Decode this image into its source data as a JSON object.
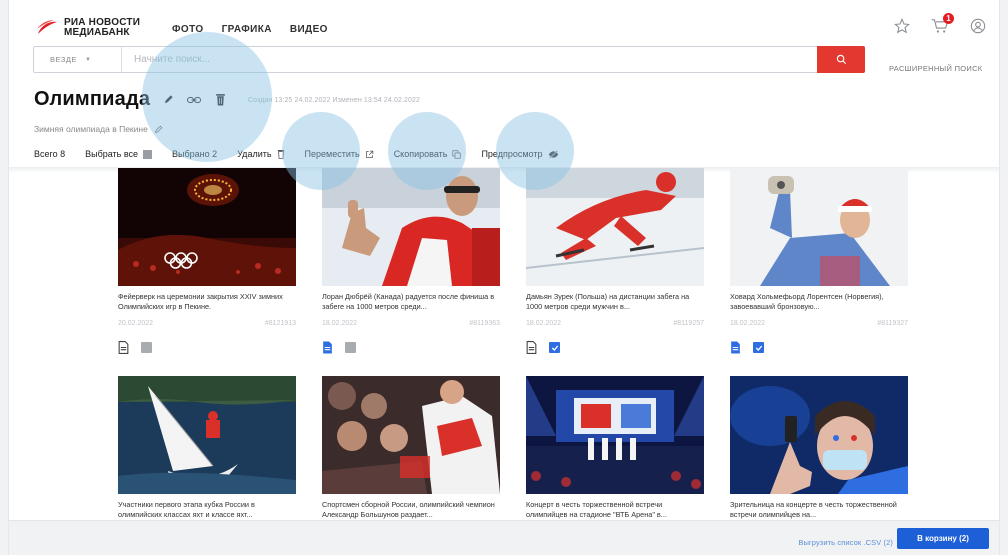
{
  "brand": {
    "line1": "РИА НОВОСТИ",
    "line2": "МЕДИАБАНК",
    "accent": "#e31e24"
  },
  "nav": [
    {
      "label": "ФОТО"
    },
    {
      "label": "ГРАФИКА"
    },
    {
      "label": "ВИДЕО"
    }
  ],
  "header_icons": [
    "star-icon",
    "cart-icon",
    "user-icon"
  ],
  "cart_badge": "1",
  "search": {
    "scope": "ВЕЗДЕ",
    "placeholder": "Начните поиск...",
    "button_icon": "search-icon",
    "button_color": "#e3382f"
  },
  "advanced_search": "РАСШИРЕННЫЙ ПОИСК",
  "collection": {
    "title": "Олимпиада",
    "meta": "Создан 13:25 24.02.2022 Изменен 13:54 24.02.2022",
    "description": "Зимняя олимпиада в Пекине"
  },
  "toolbar": {
    "total": "Всего 8",
    "select_all": "Выбрать все",
    "selected": "Выбрано 2",
    "delete": "Удалить",
    "move": "Переместить",
    "copy": "Скопировать",
    "preview": "Предпросмотр"
  },
  "cards": [
    {
      "caption": "Фейерверк на церемонии закрытия XXIV зимних Олимпийских игр в Пекине.",
      "date": "20.02.2022",
      "id": "#8121913",
      "selected": false,
      "doc_active": false
    },
    {
      "caption": "Лоран Дюбрёй (Канада) радуется после финиша в забеге на 1000 метров среди...",
      "date": "18.02.2022",
      "id": "#8119363",
      "selected": false,
      "doc_active": true
    },
    {
      "caption": "Дамьян Зурек (Польша) на дистанции забега на 1000 метров среди мужчин в...",
      "date": "18.02.2022",
      "id": "#8119257",
      "selected": true,
      "doc_active": false
    },
    {
      "caption": "Ховард Хольмефьорд Лорентсен (Норвегия), завоевавший бронзовую...",
      "date": "18.02.2022",
      "id": "#8119327",
      "selected": true,
      "doc_active": true
    },
    {
      "caption": "Участники первого этапа кубка России в олимпийских классах яхт и классе яхт..."
    },
    {
      "caption": "Спортсмен сборной России, олимпийский чемпион Александр Большунов раздает..."
    },
    {
      "caption": "Концерт в честь торжественной встречи олимпийцев на стадионе \"ВТБ Арена\" в..."
    },
    {
      "caption": "Зрительница на концерте в честь торжественной встречи олимпийцев на..."
    }
  ],
  "footer": {
    "export": "Выгрузить список .CSV (2)",
    "cart": "В корзину (2)",
    "cart_color": "#1d5fd6"
  }
}
